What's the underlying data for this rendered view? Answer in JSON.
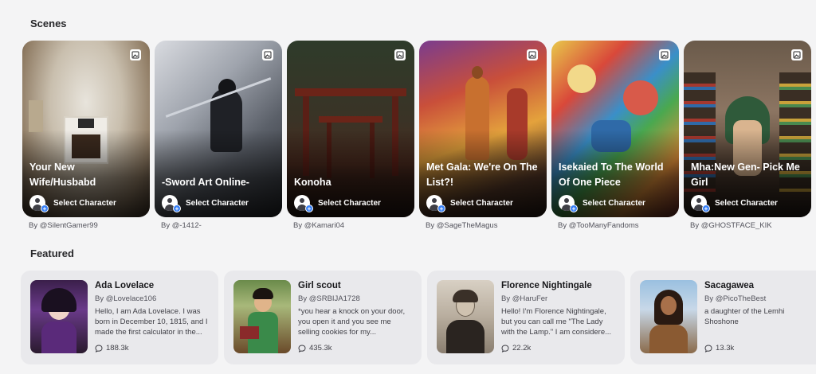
{
  "sections": {
    "scenes_title": "Scenes",
    "featured_title": "Featured"
  },
  "scenes": [
    {
      "title": "Your New Wife/Husbabd",
      "action": "Select Character",
      "author": "By @SilentGamer99",
      "icon": "image-plus-icon"
    },
    {
      "title": "-Sword Art Online-",
      "action": "Select Character",
      "author": "By @-1412-",
      "icon": "image-plus-icon"
    },
    {
      "title": "Konoha",
      "action": "Select Character",
      "author": "By @Kamari04",
      "icon": "image-plus-icon"
    },
    {
      "title": "Met Gala: We're On The List?!",
      "action": "Select Character",
      "author": "By @SageTheMagus",
      "icon": "image-plus-icon"
    },
    {
      "title": "Isekaied To The World Of One Piece",
      "action": "Select Character",
      "author": "By @TooManyFandoms",
      "icon": "image-plus-icon"
    },
    {
      "title": "Mha:New Gen- Pick Me Girl",
      "action": "Select Character",
      "author": "By @GHOSTFACE_KIK",
      "icon": "image-plus-icon"
    }
  ],
  "featured": [
    {
      "name": "Ada Lovelace",
      "author": "By @Lovelace106",
      "description": "Hello, I am Ada Lovelace. I was born in December 10, 1815, and I made the first calculator in the...",
      "count": "188.3k"
    },
    {
      "name": "Girl scout",
      "author": "By @SRBIJA1728",
      "description": "*you hear a knock on your door, you open it and you see me selling cookies for my...",
      "count": "435.3k"
    },
    {
      "name": "Florence Nightingale",
      "author": "By @HaruFer",
      "description": "Hello! I'm Florence Nightingale, but you can call me \"The Lady with the Lamp.\" I am considere...",
      "count": "22.2k"
    },
    {
      "name": "Sacagawea",
      "author": "By @PicoTheBest",
      "description": "a daughter of the Lemhi Shoshone",
      "count": "13.3k"
    }
  ],
  "colors": {
    "background": "#f4f4f5",
    "card": "#e9e9ec",
    "accent": "#3b82f6"
  }
}
